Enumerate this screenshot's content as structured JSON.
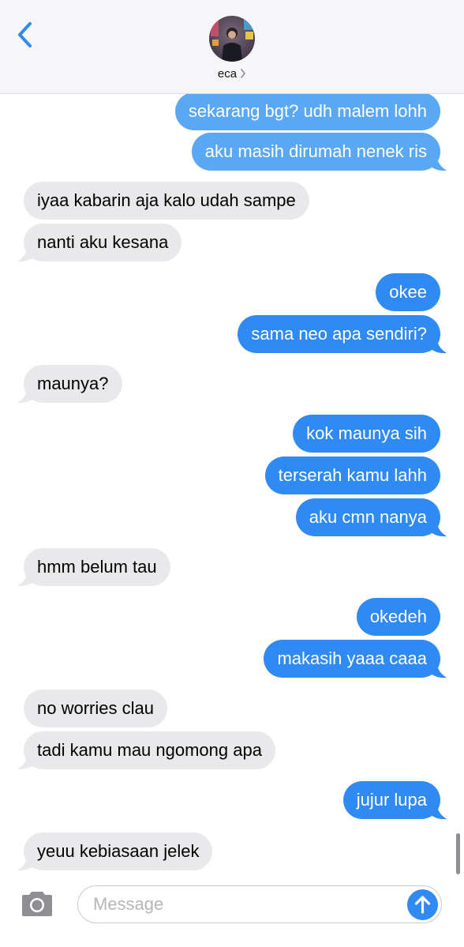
{
  "header": {
    "contact_name": "eca",
    "chevron_glyph": "›"
  },
  "messages": [
    {
      "side": "out",
      "text": "sekarang bgt? udh malem lohh",
      "shade": "light"
    },
    {
      "side": "out",
      "text": "aku masih dirumah nenek ris",
      "shade": "light",
      "tail": true
    },
    {
      "side": "in",
      "text": "iyaa kabarin aja kalo udah sampe"
    },
    {
      "side": "in",
      "text": "nanti aku kesana",
      "tail": true
    },
    {
      "side": "out",
      "text": "okee"
    },
    {
      "side": "out",
      "text": "sama neo apa sendiri?",
      "tail": true
    },
    {
      "side": "in",
      "text": "maunya?",
      "tail": true
    },
    {
      "side": "out",
      "text": "kok maunya sih"
    },
    {
      "side": "out",
      "text": "terserah kamu lahh"
    },
    {
      "side": "out",
      "text": "aku cmn nanya",
      "tail": true
    },
    {
      "side": "in",
      "text": "hmm belum tau",
      "tail": true
    },
    {
      "side": "out",
      "text": "okedeh"
    },
    {
      "side": "out",
      "text": "makasih yaaa caaa",
      "tail": true
    },
    {
      "side": "in",
      "text": "no worries clau"
    },
    {
      "side": "in",
      "text": "tadi kamu mau ngomong apa",
      "tail": true
    },
    {
      "side": "out",
      "text": "jujur lupa",
      "tail": true
    },
    {
      "side": "in",
      "text": "yeuu kebiasaan jelek",
      "tail": true
    }
  ],
  "composer": {
    "placeholder": "Message"
  },
  "colors": {
    "outgoing": "#2f8bf3",
    "outgoing_light": "#5aa7f4",
    "incoming": "#e9e9eb",
    "accent": "#2f8bf3"
  },
  "icons": {
    "back": "chevron-left-icon",
    "camera": "camera-icon",
    "send": "arrow-up-icon"
  }
}
